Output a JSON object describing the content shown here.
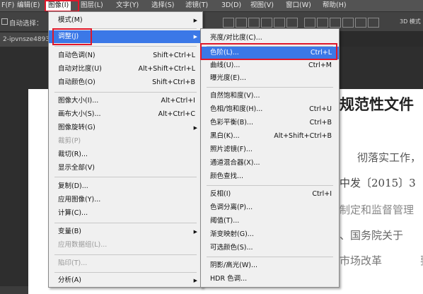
{
  "menubar": {
    "items": [
      {
        "label": "F(F)"
      },
      {
        "label": "编辑(E)"
      },
      {
        "label": "图像(I)"
      },
      {
        "label": "图层(L)"
      },
      {
        "label": "文字(Y)"
      },
      {
        "label": "选择(S)"
      },
      {
        "label": "滤镜(T)"
      },
      {
        "label": "3D(D)"
      },
      {
        "label": "视图(V)"
      },
      {
        "label": "窗口(W)"
      },
      {
        "label": "帮助(H)"
      }
    ]
  },
  "options_bar": {
    "auto_select_label": "自动选择：",
    "right_text": "3D 模式"
  },
  "doc_tab": {
    "label": "2-ipvnsze4893"
  },
  "image_menu": {
    "items": [
      {
        "label": "模式(M)",
        "shortcut": ""
      },
      {
        "label": "调整(J)",
        "shortcut": ""
      },
      {
        "label": "自动色调(N)",
        "shortcut": "Shift+Ctrl+L"
      },
      {
        "label": "自动对比度(U)",
        "shortcut": "Alt+Shift+Ctrl+L"
      },
      {
        "label": "自动颜色(O)",
        "shortcut": "Shift+Ctrl+B"
      },
      {
        "label": "图像大小(I)...",
        "shortcut": "Alt+Ctrl+I"
      },
      {
        "label": "画布大小(S)...",
        "shortcut": "Alt+Ctrl+C"
      },
      {
        "label": "图像旋转(G)",
        "shortcut": ""
      },
      {
        "label": "裁剪(P)",
        "shortcut": ""
      },
      {
        "label": "裁切(R)...",
        "shortcut": ""
      },
      {
        "label": "显示全部(V)",
        "shortcut": ""
      },
      {
        "label": "复制(D)...",
        "shortcut": ""
      },
      {
        "label": "应用图像(Y)...",
        "shortcut": ""
      },
      {
        "label": "计算(C)...",
        "shortcut": ""
      },
      {
        "label": "变量(B)",
        "shortcut": ""
      },
      {
        "label": "应用数据组(L)...",
        "shortcut": ""
      },
      {
        "label": "陷印(T)...",
        "shortcut": ""
      },
      {
        "label": "分析(A)",
        "shortcut": ""
      }
    ]
  },
  "adjust_menu": {
    "items": [
      {
        "label": "亮度/对比度(C)...",
        "shortcut": ""
      },
      {
        "label": "色阶(L)...",
        "shortcut": "Ctrl+L"
      },
      {
        "label": "曲线(U)...",
        "shortcut": "Ctrl+M"
      },
      {
        "label": "曝光度(E)...",
        "shortcut": ""
      },
      {
        "label": "自然饱和度(V)...",
        "shortcut": ""
      },
      {
        "label": "色相/饱和度(H)...",
        "shortcut": "Ctrl+U"
      },
      {
        "label": "色彩平衡(B)...",
        "shortcut": "Ctrl+B"
      },
      {
        "label": "黑白(K)...",
        "shortcut": "Alt+Shift+Ctrl+B"
      },
      {
        "label": "照片滤镜(F)...",
        "shortcut": ""
      },
      {
        "label": "通道混合器(X)...",
        "shortcut": ""
      },
      {
        "label": "颜色查找...",
        "shortcut": ""
      },
      {
        "label": "反相(I)",
        "shortcut": "Ctrl+I"
      },
      {
        "label": "色调分离(P)...",
        "shortcut": ""
      },
      {
        "label": "阈值(T)...",
        "shortcut": ""
      },
      {
        "label": "渐变映射(G)...",
        "shortcut": ""
      },
      {
        "label": "可选颜色(S)...",
        "shortcut": ""
      },
      {
        "label": "阴影/高光(W)...",
        "shortcut": ""
      },
      {
        "label": "HDR 色调...",
        "shortcut": ""
      }
    ]
  },
  "document": {
    "lines": [
      "规范性文件",
      "彻落实工作，",
      "中发〔2015〕3",
      "制定和监督管理",
      "、国务院关于",
      "市场改革",
      "要"
    ]
  },
  "colors": {
    "highlight": "#3b78e7",
    "callout": "#e0172a"
  }
}
